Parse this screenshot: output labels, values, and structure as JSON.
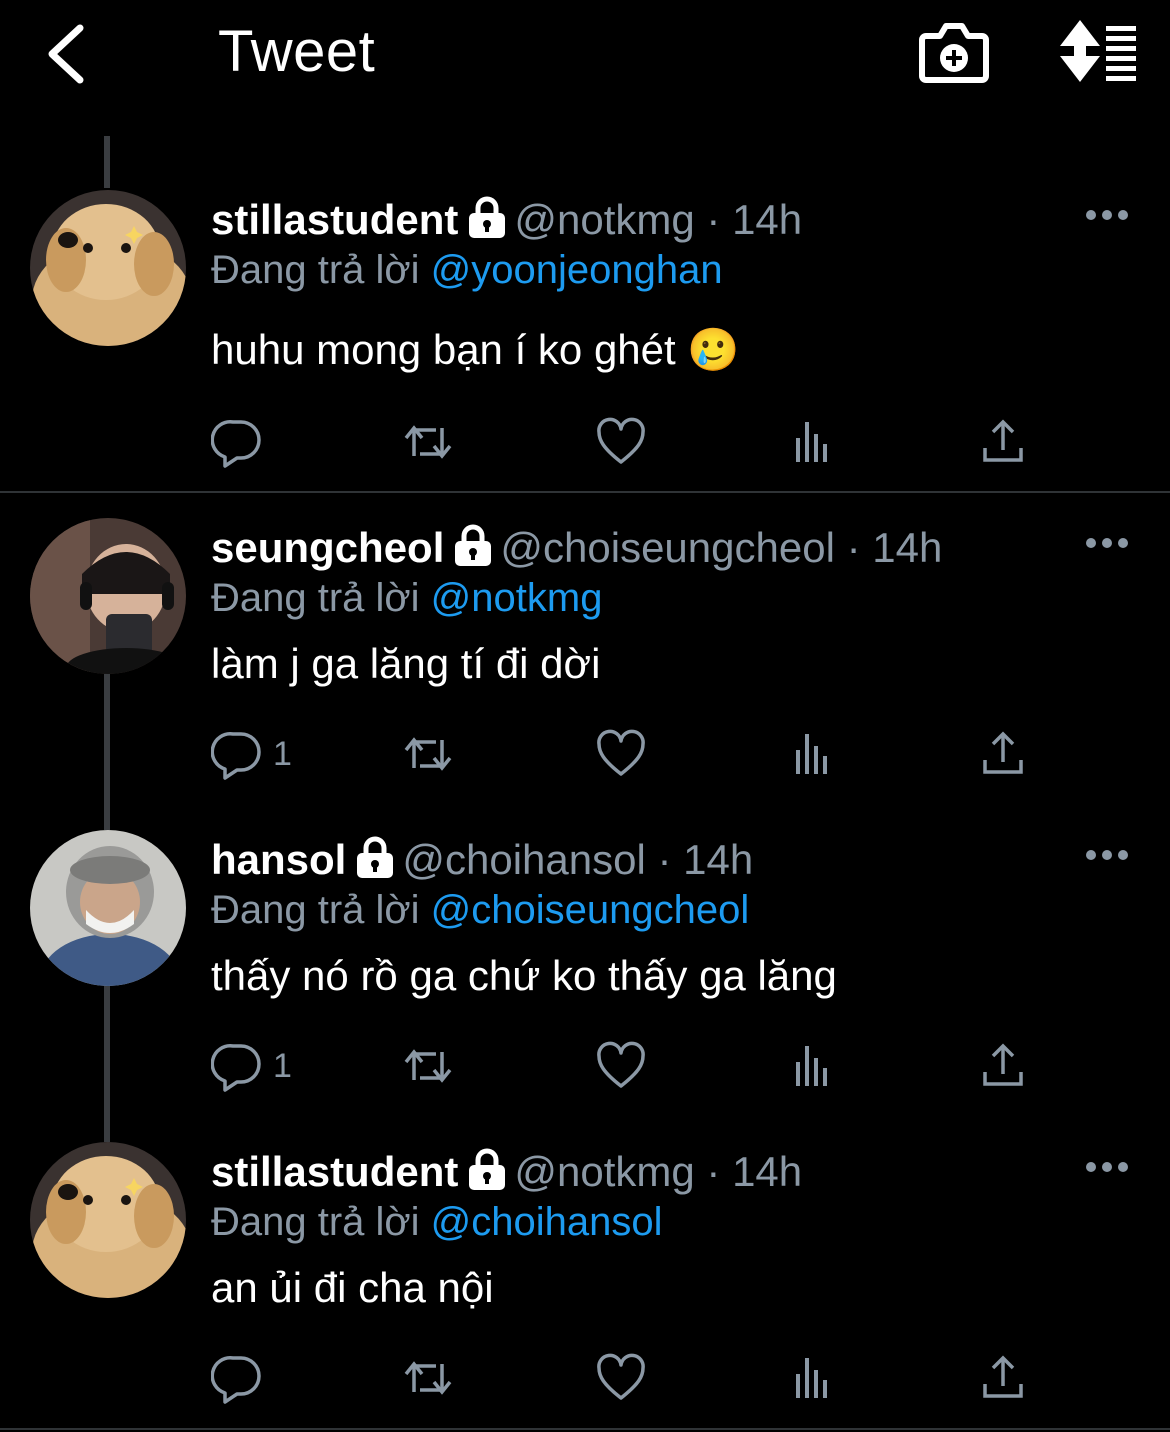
{
  "header": {
    "title": "Tweet"
  },
  "tweets": [
    {
      "name": "stillastudent",
      "handle": "@notkmg",
      "time": "· 14h",
      "reply_label": "Đang trả lời",
      "reply_to": "@yoonjeonghan",
      "text": "huhu mong bạn í ko ghét",
      "emoji": "🥲",
      "reply_count": "",
      "avatar": "dog"
    },
    {
      "name": "seungcheol",
      "handle": "@choiseungcheol",
      "time": "· 14h",
      "reply_label": "Đang trả lời",
      "reply_to": "@notkmg",
      "text": "làm j ga lăng tí đi dời",
      "emoji": "",
      "reply_count": "1",
      "avatar": "person-headphones"
    },
    {
      "name": "hansol",
      "handle": "@choihansol",
      "time": "· 14h",
      "reply_label": "Đang trả lời",
      "reply_to": "@choiseungcheol",
      "text": "thấy nó rồ ga chứ ko thấy ga lăng",
      "emoji": "",
      "reply_count": "1",
      "avatar": "person-mask"
    },
    {
      "name": "stillastudent",
      "handle": "@notkmg",
      "time": "· 14h",
      "reply_label": "Đang trả lời",
      "reply_to": "@choihansol",
      "text": "an ủi đi cha nội",
      "emoji": "",
      "reply_count": "",
      "avatar": "dog"
    }
  ],
  "colors": {
    "background": "#000000",
    "accent": "#1d9bf0",
    "muted": "#8b98a5",
    "divider": "#2f3336"
  }
}
